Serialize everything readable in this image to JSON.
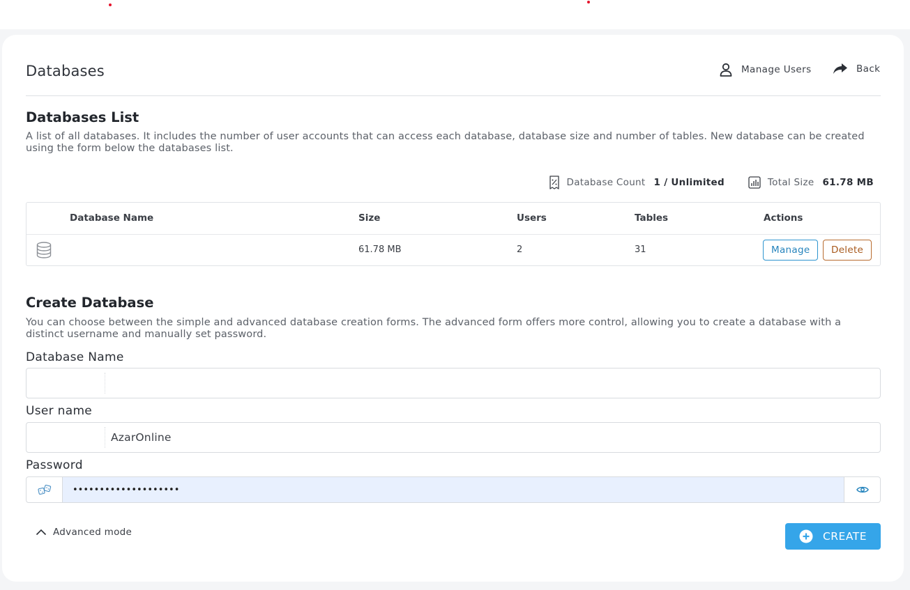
{
  "header": {
    "title": "Databases",
    "manage_users_label": "Manage Users",
    "back_label": "Back"
  },
  "list": {
    "title": "Databases List",
    "description": "A list of all databases. It includes the number of user accounts that can access each database, database size and number of tables. New database can be created using the form below the databases list.",
    "stats": {
      "count_label": "Database Count",
      "count_value": "1 / Unlimited",
      "size_label": "Total Size",
      "size_value": "61.78 MB"
    },
    "columns": [
      "Database Name",
      "Size",
      "Users",
      "Tables",
      "Actions"
    ],
    "rows": [
      {
        "name": "",
        "size": "61.78 MB",
        "users": "2",
        "tables": "31",
        "manage_label": "Manage",
        "delete_label": "Delete"
      }
    ]
  },
  "create": {
    "title": "Create Database",
    "description": "You can choose between the simple and advanced database creation forms. The advanced form offers more control, allowing you to create a database with a distinct username and manually set password.",
    "db_name_label": "Database Name",
    "db_name_value": "",
    "user_name_label": "User name",
    "user_name_value": "AzarOnline",
    "password_label": "Password",
    "password_value": "••••••••••••••••••••",
    "advanced_label": "Advanced mode",
    "create_label": "CREATE"
  },
  "colors": {
    "accent": "#35a5e9",
    "manage": "#2684bd",
    "delete": "#a85a1e",
    "autofill": "#e8f0fe"
  }
}
